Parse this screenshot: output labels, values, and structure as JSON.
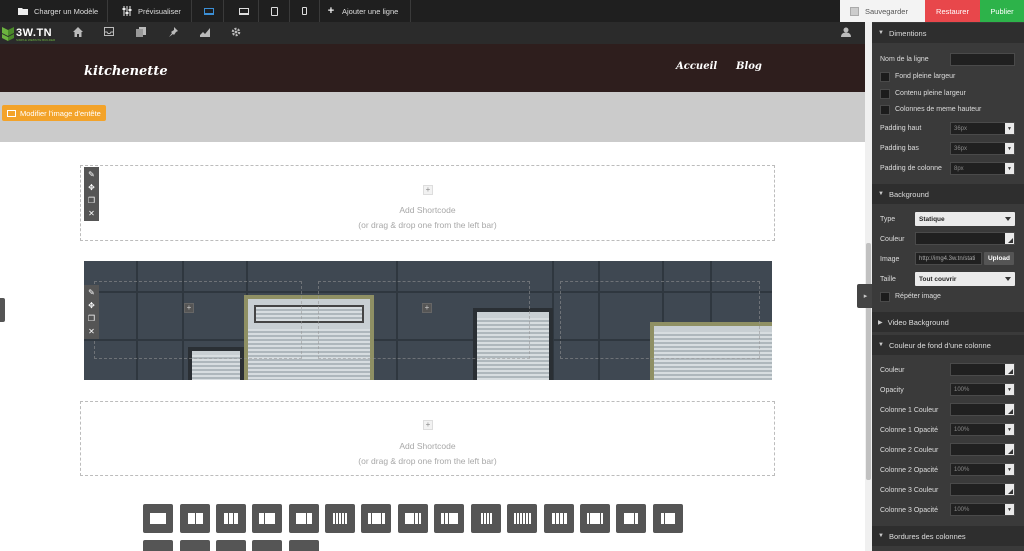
{
  "toolbar": {
    "load_template": "Charger un Modèle",
    "preview": "Prévisualiser",
    "add_row": "Ajouter une ligne",
    "save": "Sauvegarder",
    "restore": "Restaurer",
    "publish": "Publier"
  },
  "logo": {
    "text": "3W.TN",
    "tagline": "SIMPLE WEBSITE BUILDER"
  },
  "site": {
    "brand": "kitchenette",
    "menu": [
      "Accueil",
      "Blog"
    ],
    "header_image_button": "Modifier l'image d'entête"
  },
  "rows": {
    "add_shortcode": "Add Shortcode",
    "drag_hint": "(or drag & drop one from the left bar)"
  },
  "sidebar": {
    "dimensions": {
      "title": "Dimentions",
      "row_name_label": "Nom de la ligne",
      "row_name_value": "",
      "full_bg": "Fond pleine largeur",
      "full_content": "Contenu pleine largeur",
      "same_height": "Colonnes de meme hauteur",
      "padding_top_label": "Padding haut",
      "padding_top_value": "36px",
      "padding_bottom_label": "Padding bas",
      "padding_bottom_value": "36px",
      "padding_col_label": "Padding de colonne",
      "padding_col_value": "8px"
    },
    "background": {
      "title": "Background",
      "type_label": "Type",
      "type_value": "Statique",
      "color_label": "Couleur",
      "image_label": "Image",
      "image_value": "http://img4.3w.tn/stati",
      "upload": "Upload",
      "size_label": "Taille",
      "size_value": "Tout couvrir",
      "repeat": "Répéter image"
    },
    "video_bg": {
      "title": "Video Background"
    },
    "column_bg": {
      "title": "Couleur de fond d'une colonne",
      "color_label": "Couleur",
      "opacity_label": "Opacity",
      "opacity_value": "100%",
      "col1_color": "Colonne 1 Couleur",
      "col1_opacity": "Colonne 1 Opacité",
      "col1_opacity_value": "100%",
      "col2_color": "Colonne 2 Couleur",
      "col2_opacity": "Colonne 2 Opacité",
      "col2_opacity_value": "100%",
      "col3_color": "Colonne 3 Couleur",
      "col3_opacity": "Colonne 3 Opacité",
      "col3_opacity_value": "100%"
    },
    "borders": {
      "title": "Bordures des colonnes"
    }
  },
  "colors": {
    "restore": "#e8474b",
    "publish": "#2db34a",
    "header_button": "#f3a32a",
    "site_header": "#2e1e1d"
  }
}
